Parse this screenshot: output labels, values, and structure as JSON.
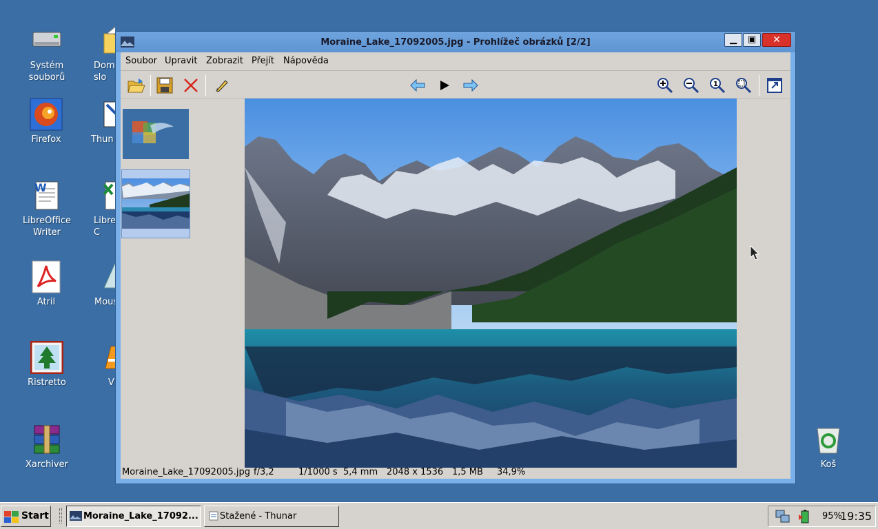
{
  "desktop": {
    "icons": [
      {
        "label": "Systém\nsouborů"
      },
      {
        "label": "Dom\nslo"
      },
      {
        "label": "Firefox"
      },
      {
        "label": "Thun"
      },
      {
        "label": "LibreOffice\nWriter"
      },
      {
        "label": "Libre\nC"
      },
      {
        "label": "Atril"
      },
      {
        "label": "Mous"
      },
      {
        "label": "Ristretto"
      },
      {
        "label": "V"
      },
      {
        "label": "Xarchiver"
      },
      {
        "label": "Koš"
      }
    ]
  },
  "window": {
    "title": "Moraine_Lake_17092005.jpg - Prohlížeč obrázků [2/2]",
    "close_glyph": "✕",
    "menu": [
      "Soubor",
      "Upravit",
      "Zobrazit",
      "Přejít",
      "Nápověda"
    ],
    "toolbar_icons": [
      "open-icon",
      "save-icon",
      "delete-icon",
      "edit-icon",
      "back-arrow-icon",
      "play-icon",
      "forward-arrow-icon",
      "zoom-in-icon",
      "zoom-out-icon",
      "zoom-100-icon",
      "zoom-fit-icon",
      "fullscreen-icon"
    ],
    "status": {
      "filename": "Moraine_Lake_17092005.jpg",
      "aperture": "f/3,2",
      "exposure": "1/1000 s",
      "focal": "5,4 mm",
      "dimensions": "2048 x 1536",
      "size": "1,5 MB",
      "zoom": "34,9%"
    }
  },
  "taskbar": {
    "start_label": "Start",
    "tasks": [
      {
        "label": "Moraine_Lake_17092...",
        "active": true
      },
      {
        "label": "Stažené - Thunar",
        "active": false
      }
    ],
    "battery": "95%",
    "clock": "19:35"
  },
  "colors": {
    "desktop_bg": "#3a6ea5",
    "titlebar": "#6fa4de",
    "close_button": "#d9322b",
    "window_bg": "#d6d3ce"
  }
}
